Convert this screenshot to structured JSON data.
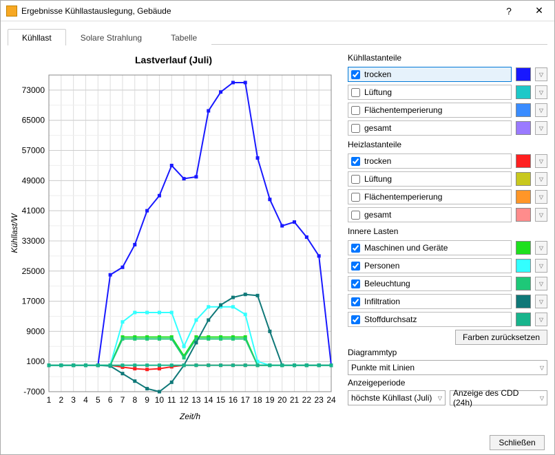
{
  "window": {
    "title": "Ergebnisse Kühllastauslegung, Gebäude"
  },
  "tabs": {
    "t0": "Kühllast",
    "t1": "Solare Strahlung",
    "t2": "Tabelle"
  },
  "chart_title": "Lastverlauf (Juli)",
  "xlabel": "Zeit/h",
  "ylabel": "Kühllast/W",
  "chart_data": {
    "type": "line",
    "xlabel": "Zeit/h",
    "ylabel": "Kühllast/W",
    "title": "Lastverlauf (Juli)",
    "x": [
      1,
      2,
      3,
      4,
      5,
      6,
      7,
      8,
      9,
      10,
      11,
      12,
      13,
      14,
      15,
      16,
      17,
      18,
      19,
      20,
      21,
      22,
      23,
      24
    ],
    "ylim": [
      -7000,
      77000
    ],
    "yticks": [
      -7000,
      1000,
      9000,
      17000,
      25000,
      33000,
      41000,
      49000,
      57000,
      65000,
      73000
    ],
    "series": [
      {
        "name": "trocken (Kühl)",
        "color": "#1818ff",
        "values": [
          0,
          0,
          0,
          0,
          0,
          24000,
          26000,
          32000,
          41000,
          45000,
          53000,
          49500,
          50000,
          67500,
          72500,
          75000,
          75000,
          55000,
          44000,
          37000,
          38000,
          34000,
          29000,
          0
        ]
      },
      {
        "name": "trocken (Heiz)",
        "color": "#ff2020",
        "values": [
          0,
          0,
          0,
          0,
          0,
          0,
          -500,
          -900,
          -1100,
          -900,
          -400,
          0,
          0,
          0,
          0,
          0,
          0,
          0,
          0,
          0,
          0,
          0,
          0,
          0
        ]
      },
      {
        "name": "Maschinen und Geräte",
        "color": "#1ee01e",
        "values": [
          0,
          0,
          0,
          0,
          0,
          0,
          7500,
          7500,
          7500,
          7500,
          7500,
          2500,
          7500,
          7500,
          7500,
          7500,
          7500,
          0,
          0,
          0,
          0,
          0,
          0,
          0
        ]
      },
      {
        "name": "Personen",
        "color": "#33ffff",
        "values": [
          0,
          0,
          0,
          0,
          0,
          0,
          11500,
          14000,
          14000,
          14000,
          14000,
          5000,
          12000,
          15500,
          15500,
          15500,
          13500,
          1000,
          0,
          0,
          0,
          0,
          0,
          0
        ]
      },
      {
        "name": "Beleuchtung",
        "color": "#1ec878",
        "values": [
          0,
          0,
          0,
          0,
          0,
          0,
          7000,
          7000,
          7000,
          7000,
          7000,
          2000,
          7000,
          7000,
          7000,
          7000,
          7000,
          0,
          0,
          0,
          0,
          0,
          0,
          0
        ]
      },
      {
        "name": "Infiltration",
        "color": "#0f7878",
        "values": [
          0,
          0,
          0,
          0,
          0,
          -200,
          -2200,
          -4200,
          -6200,
          -7000,
          -4500,
          0,
          6000,
          12000,
          16000,
          18000,
          18800,
          18500,
          9000,
          0,
          0,
          0,
          0,
          0
        ]
      },
      {
        "name": "Stoffdurchsatz",
        "color": "#18b48c",
        "values": [
          0,
          0,
          0,
          0,
          0,
          0,
          0,
          0,
          0,
          0,
          0,
          0,
          0,
          0,
          0,
          0,
          0,
          0,
          0,
          0,
          0,
          0,
          0,
          0
        ]
      }
    ]
  },
  "sections": {
    "kuehl": "Kühllastanteile",
    "heiz": "Heizlastanteile",
    "inner": "Innere Lasten"
  },
  "legend": {
    "kuehl": [
      {
        "label": "trocken",
        "checked": true,
        "selected": true,
        "color": "#1818ff"
      },
      {
        "label": "Lüftung",
        "checked": false,
        "color": "#1ec8c8"
      },
      {
        "label": "Flächentemperierung",
        "checked": false,
        "color": "#3a8cff"
      },
      {
        "label": "gesamt",
        "checked": false,
        "color": "#9a7aff"
      }
    ],
    "heiz": [
      {
        "label": "trocken",
        "checked": true,
        "color": "#ff2020"
      },
      {
        "label": "Lüftung",
        "checked": false,
        "color": "#c8c81e"
      },
      {
        "label": "Flächentemperierung",
        "checked": false,
        "color": "#ff9628"
      },
      {
        "label": "gesamt",
        "checked": false,
        "color": "#ff8c8c"
      }
    ],
    "inner": [
      {
        "label": "Maschinen und Geräte",
        "checked": true,
        "color": "#1ee01e"
      },
      {
        "label": "Personen",
        "checked": true,
        "color": "#33ffff"
      },
      {
        "label": "Beleuchtung",
        "checked": true,
        "color": "#1ec878"
      },
      {
        "label": "Infiltration",
        "checked": true,
        "color": "#0f7878"
      },
      {
        "label": "Stoffdurchsatz",
        "checked": true,
        "color": "#18b48c"
      }
    ]
  },
  "btn_reset": "Farben zurücksetzen",
  "lbl_diagtype": "Diagrammtyp",
  "sel_diagtype": "Punkte mit Linien",
  "lbl_period": "Anzeigeperiode",
  "sel_period_1": "höchste Kühllast (Juli)",
  "sel_period_2": "Anzeige des CDD (24h)",
  "btn_close": "Schließen"
}
